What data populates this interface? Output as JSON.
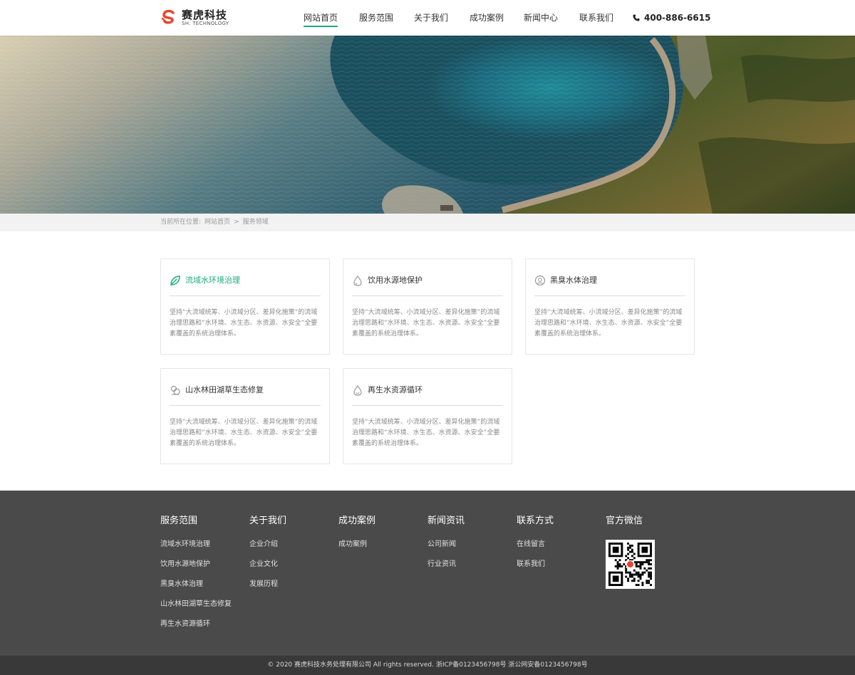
{
  "brand": {
    "name_cn": "赛虎科技",
    "name_en": "SH. TECHNOLOGY",
    "accent": "#1aad7c",
    "logo_color": "#e8452c"
  },
  "nav": {
    "items": [
      {
        "label": "网站首页",
        "active": true
      },
      {
        "label": "服务范围",
        "active": false
      },
      {
        "label": "关于我们",
        "active": false
      },
      {
        "label": "成功案例",
        "active": false
      },
      {
        "label": "新闻中心",
        "active": false
      },
      {
        "label": "联系我们",
        "active": false
      }
    ],
    "phone_icon": "phone-icon",
    "phone": "400-886-6615"
  },
  "breadcrumb": {
    "prefix": "当前所在位置:",
    "items": [
      "网站首页",
      ">",
      "服务领域"
    ]
  },
  "services": [
    {
      "title": "流域水环境治理",
      "icon": "leaf-icon",
      "active": true,
      "desc": "坚持“大流域统筹、小流域分区、差异化施策”的流域治理思路和“水环境、水生态、水资源、水安全”全要素覆盖的系统治理体系。"
    },
    {
      "title": "饮用水源地保护",
      "icon": "water-drop-icon",
      "active": false,
      "desc": "坚持“大流域统筹、小流域分区、差异化施策”的流域治理思路和“水环境、水生态、水资源、水安全”全要素覆盖的系统治理体系。"
    },
    {
      "title": "黑臭水体治理",
      "icon": "face-icon",
      "active": false,
      "desc": "坚持“大流域统筹、小流域分区、差异化施策”的流域治理思路和“水环境、水生态、水资源、水安全”全要素覆盖的系统治理体系。"
    },
    {
      "title": "山水林田湖草生态修复",
      "icon": "mountain-icon",
      "active": false,
      "desc": "坚持“大流域统筹、小流域分区、差异化施策”的流域治理思路和“水环境、水生态、水资源、水安全”全要素覆盖的系统治理体系。"
    },
    {
      "title": "再生水资源循环",
      "icon": "recycle-drop-icon",
      "active": false,
      "desc": "坚持“大流域统筹、小流域分区、差异化施策”的流域治理思路和“水环境、水生态、水资源、水安全”全要素覆盖的系统治理体系。"
    }
  ],
  "footer": {
    "columns": [
      {
        "title": "服务范围",
        "links": [
          "流域水环境治理",
          "饮用水源地保护",
          "黑臭水体治理",
          "山水林田湖草生态修复",
          "再生水资源循环"
        ]
      },
      {
        "title": "关于我们",
        "links": [
          "企业介绍",
          "企业文化",
          "发展历程"
        ]
      },
      {
        "title": "成功案例",
        "links": [
          "成功案例"
        ]
      },
      {
        "title": "新闻资讯",
        "links": [
          "公司新闻",
          "行业资讯"
        ]
      },
      {
        "title": "联系方式",
        "links": [
          "在线留言",
          "联系我们"
        ]
      }
    ],
    "wechat_title": "官方微信",
    "qr_icon": "qr-code-icon",
    "copyright": "© 2020 赛虎科技水务处理有限公司 All rights reserved. 浙ICP备0123456798号 浙公网安备0123456798号"
  }
}
